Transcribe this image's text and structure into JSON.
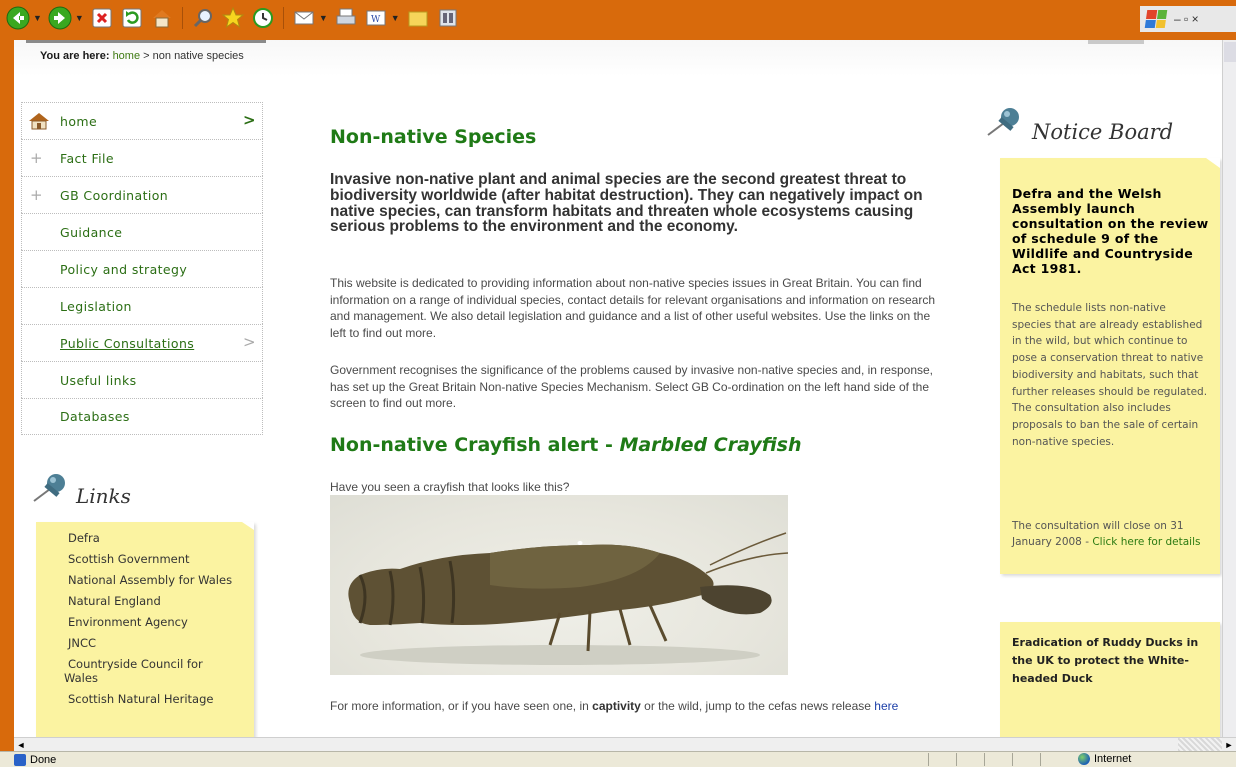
{
  "browser": {
    "toolbar_icons": [
      "back-icon",
      "forward-icon",
      "stop-icon",
      "refresh-icon",
      "home-icon",
      "search-icon",
      "favorites-icon",
      "history-icon",
      "mail-icon",
      "print-icon",
      "edit-icon",
      "folder-icon",
      "media-icon"
    ],
    "window_controls": "– ▫ ×",
    "status_text": "Done",
    "zone_text": "Internet"
  },
  "breadcrumb": {
    "label": "You are here:",
    "home": "home",
    "separator": ">",
    "current": "non native species"
  },
  "nav": {
    "items": [
      {
        "label": "home",
        "icon": "home-icon",
        "arrow": ">"
      },
      {
        "label": "Fact File",
        "icon": "plus-icon"
      },
      {
        "label": "GB Coordination",
        "icon": "plus-icon"
      },
      {
        "label": "Guidance"
      },
      {
        "label": "Policy and strategy"
      },
      {
        "label": "Legislation"
      },
      {
        "label": "Public Consultations",
        "arrow": ">"
      },
      {
        "label": "Useful links"
      },
      {
        "label": "Databases"
      }
    ]
  },
  "links": {
    "heading": "Links",
    "items": [
      "Defra",
      "Scottish Government",
      "National Assembly for Wales",
      "Natural England",
      "Environment Agency",
      "JNCC",
      "Countryside Council for Wales",
      "Scottish Natural Heritage"
    ]
  },
  "main": {
    "title": "Non-native Species",
    "lead": "Invasive non-native plant and animal species are the second greatest threat to biodiversity worldwide (after habitat destruction). They can negatively impact on native species, can transform habitats and threaten whole ecosystems causing serious problems to the environment and the economy.",
    "p1": "This website is dedicated to providing information about non-native species issues in Great Britain. You can find information on a range of individual species, contact details for relevant organisations and information on research and management. We also detail legislation and guidance and a list of other useful websites. Use the links on the left to find out more.",
    "p2": "Government recognises the significance of the problems caused by invasive non-native species and, in response, has set up the Great Britain Non-native Species Mechanism. Select GB Co-ordination on the left hand side of the screen to find out more.",
    "alert_title": "Non-native Crayfish alert - ",
    "alert_species": "Marbled Crayfish",
    "ask": "Have you seen a crayfish that looks like this?",
    "more_before": "For more information, or if you have seen one, in ",
    "more_bold": "captivity",
    "more_after": " or the wild, jump to the cefas news release ",
    "more_link": "here"
  },
  "notice": {
    "heading": "Notice Board",
    "title": "Defra and the Welsh Assembly launch consultation on the review of schedule 9 of the Wildlife and Countryside Act 1981.",
    "body": "The schedule lists non-native species that are already established in the wild, but which continue to pose a conservation threat to native biodiversity and habitats, such that further releases should be regulated. The consultation also includes proposals to ban the sale of certain non-native species.",
    "close_text": "The consultation will close on 31 January 2008 - ",
    "close_link": "Click here for details",
    "second": "Eradication of Ruddy Ducks in the UK to protect the White-headed Duck"
  },
  "colors": {
    "browser_frame": "#d86a0c",
    "heading_green": "#1f7a16",
    "sticky_note": "#fbf3a1",
    "link_blue": "#1c3fa8"
  }
}
